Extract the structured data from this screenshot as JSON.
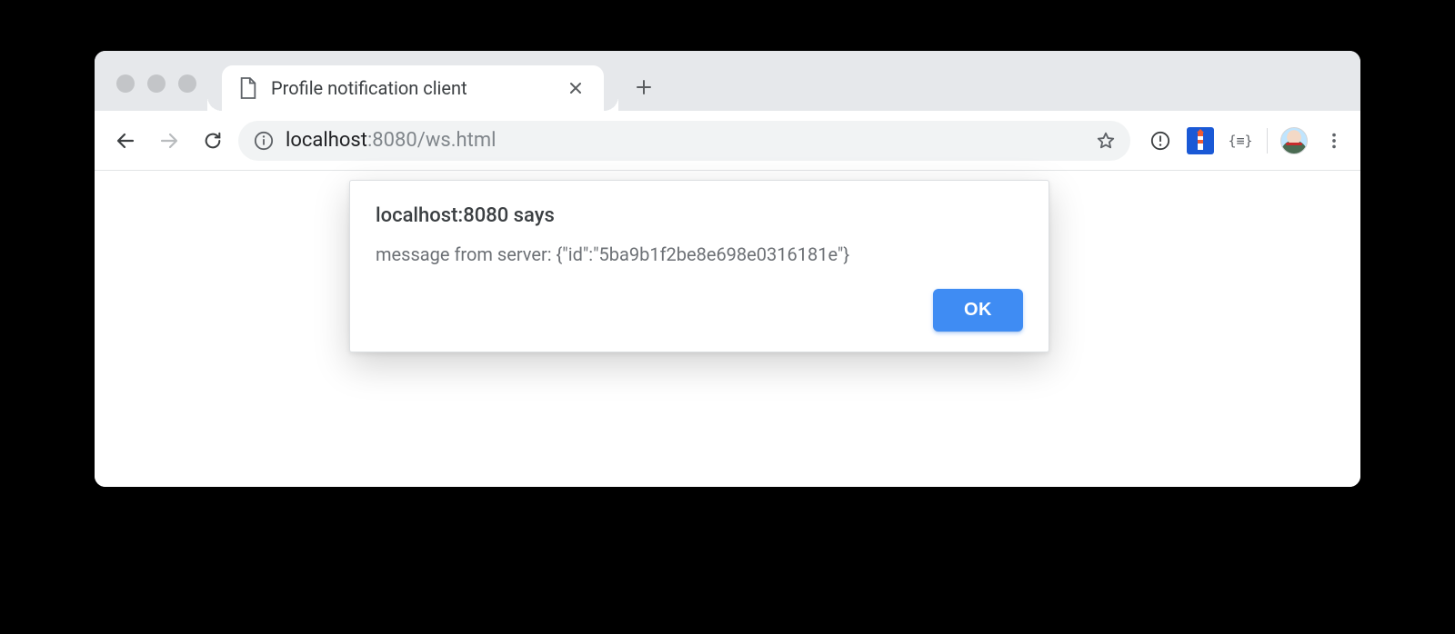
{
  "tabs": {
    "active": {
      "title": "Profile notification client"
    }
  },
  "address_bar": {
    "host": "localhost",
    "port_path": ":8080/ws.html"
  },
  "dialog": {
    "origin_says": "localhost:8080 says",
    "message": "message from server: {\"id\":\"5ba9b1f2be8e698e0316181e\"}",
    "ok_label": "OK"
  },
  "icons": {
    "extension_braces": "{≡}"
  },
  "colors": {
    "accent": "#3f8cf3"
  }
}
